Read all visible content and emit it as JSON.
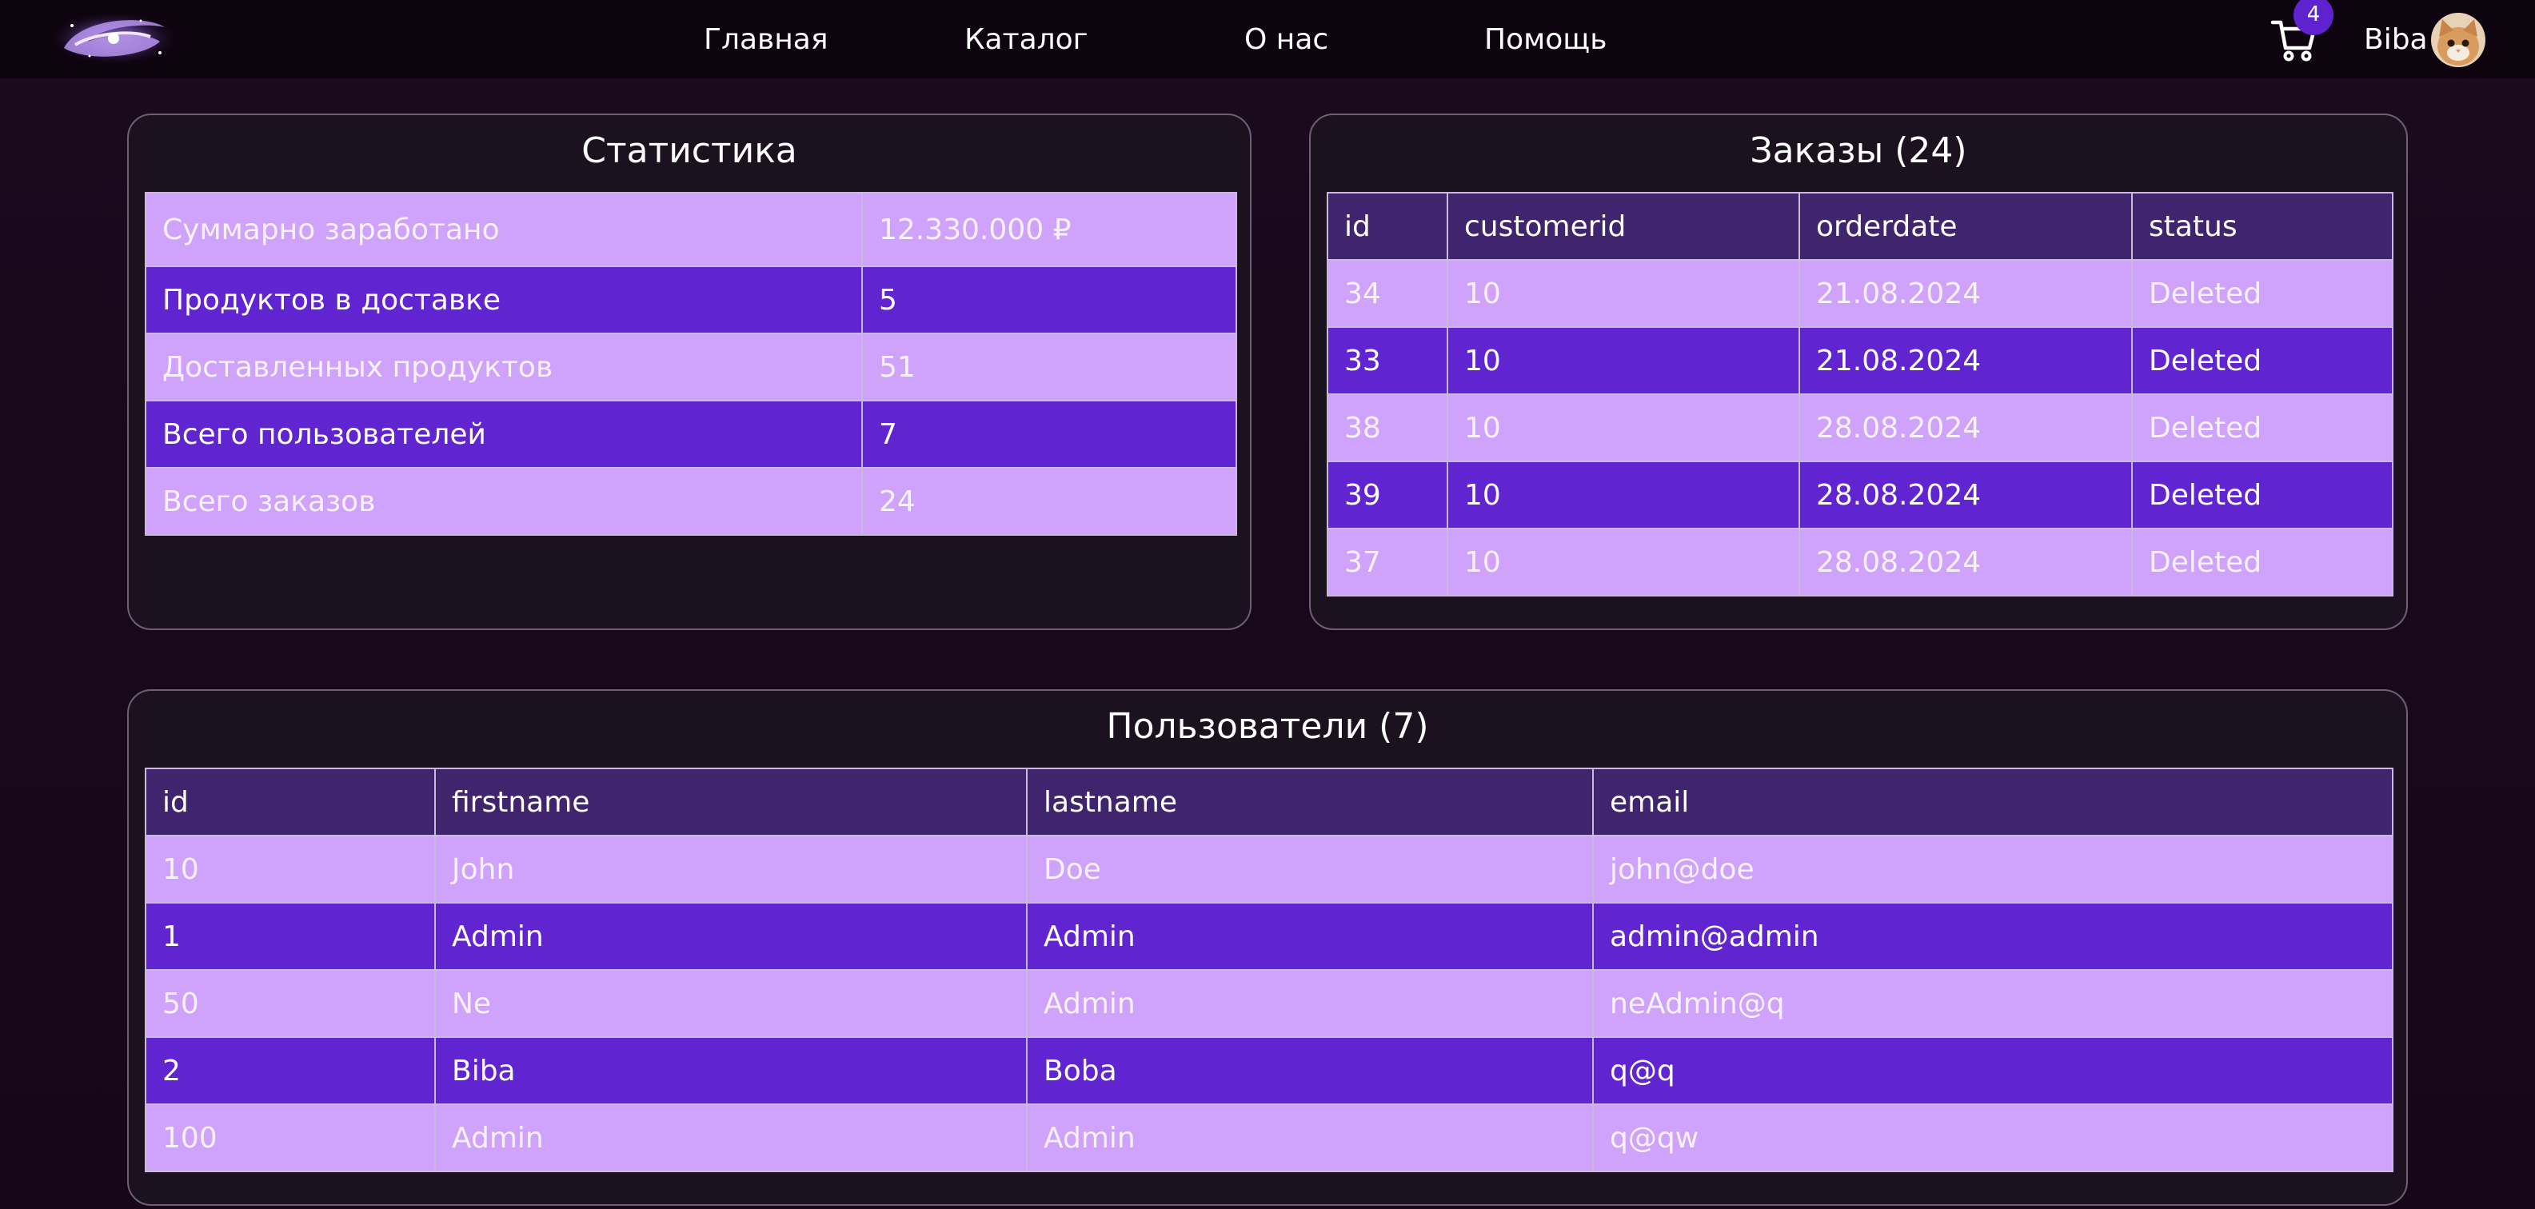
{
  "nav": {
    "links": [
      "Главная",
      "Каталог",
      "О нас",
      "Помощь"
    ],
    "cart_count": "4",
    "user_name": "Biba"
  },
  "colors": {
    "header_bg": "#0e040f",
    "page_bg": "#1a0a1f",
    "table_header": "#40246d",
    "row_light": "#cfa3fb",
    "row_dark": "#6024d0",
    "badge": "#5f22cf"
  },
  "stats": {
    "title": "Статистика",
    "rows": [
      {
        "label": "Суммарно заработано",
        "value": "12.330.000 ₽"
      },
      {
        "label": "Продуктов в доставке",
        "value": "5"
      },
      {
        "label": "Доставленных продуктов",
        "value": "51"
      },
      {
        "label": "Всего пользователей",
        "value": "7"
      },
      {
        "label": "Всего заказов",
        "value": "24"
      }
    ]
  },
  "orders": {
    "title": "Заказы (24)",
    "columns": [
      "id",
      "customerid",
      "orderdate",
      "status"
    ],
    "rows": [
      [
        "34",
        "10",
        "21.08.2024",
        "Deleted"
      ],
      [
        "33",
        "10",
        "21.08.2024",
        "Deleted"
      ],
      [
        "38",
        "10",
        "28.08.2024",
        "Deleted"
      ],
      [
        "39",
        "10",
        "28.08.2024",
        "Deleted"
      ],
      [
        "37",
        "10",
        "28.08.2024",
        "Deleted"
      ]
    ]
  },
  "users": {
    "title": "Пользователи (7)",
    "columns": [
      "id",
      "firstname",
      "lastname",
      "email"
    ],
    "rows": [
      [
        "10",
        "John",
        "Doe",
        "john@doe"
      ],
      [
        "1",
        "Admin",
        "Admin",
        "admin@admin"
      ],
      [
        "50",
        "Ne",
        "Admin",
        "neAdmin@q"
      ],
      [
        "2",
        "Biba",
        "Boba",
        "q@q"
      ],
      [
        "100",
        "Admin",
        "Admin",
        "q@qw"
      ]
    ]
  }
}
